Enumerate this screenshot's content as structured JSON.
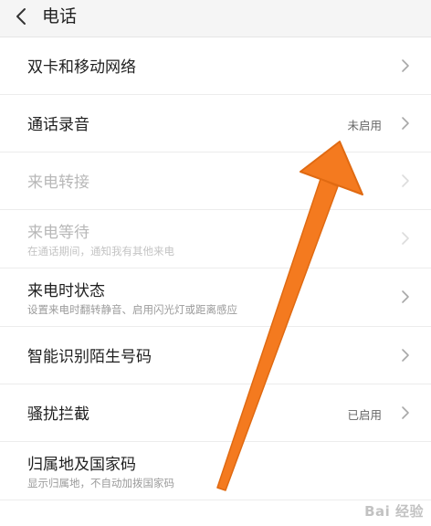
{
  "header": {
    "back_icon": "chevron-left-icon",
    "title": "电话"
  },
  "rows": [
    {
      "title": "双卡和移动网络",
      "subtitle": "",
      "status": "",
      "disabled": false
    },
    {
      "title": "通话录音",
      "subtitle": "",
      "status": "未启用",
      "disabled": false
    },
    {
      "title": "来电转接",
      "subtitle": "",
      "status": "",
      "disabled": true
    },
    {
      "title": "来电等待",
      "subtitle": "在通话期间，通知我有其他来电",
      "status": "",
      "disabled": true
    },
    {
      "title": "来电时状态",
      "subtitle": "设置来电时翻转静音、启用闪光灯或距离感应",
      "status": "",
      "disabled": false
    },
    {
      "title": "智能识别陌生号码",
      "subtitle": "",
      "status": "",
      "disabled": false
    },
    {
      "title": "骚扰拦截",
      "subtitle": "",
      "status": "已启用",
      "disabled": false
    },
    {
      "title": "归属地及国家码",
      "subtitle": "显示归属地，不自动加拨国家码",
      "status": "",
      "disabled": false
    }
  ],
  "annotation": {
    "arrow_color": "#f47a1f",
    "arrow_icon": "orange-arrow-annotation"
  },
  "watermark": {
    "text": "Bai 经验"
  }
}
